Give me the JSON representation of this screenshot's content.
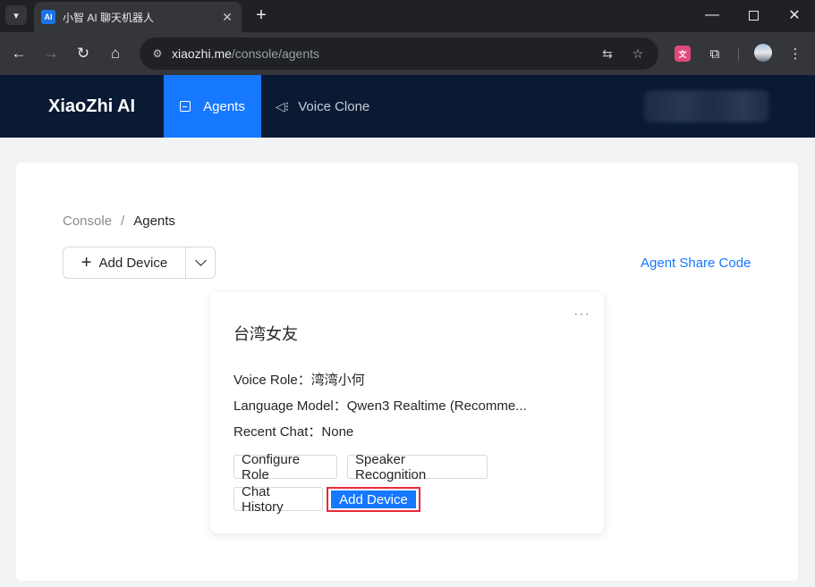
{
  "browser": {
    "tab_title": "小智 AI 聊天机器人",
    "favicon_text": "AI",
    "url_host": "xiaozhi.me",
    "url_path": "/console/agents"
  },
  "header": {
    "logo": "XiaoZhi AI",
    "nav": [
      {
        "label": "Agents",
        "active": true
      },
      {
        "label": "Voice Clone",
        "active": false
      }
    ]
  },
  "breadcrumb": {
    "root": "Console",
    "separator": "/",
    "current": "Agents"
  },
  "actions": {
    "add_device_label": "Add Device",
    "share_code_label": "Agent Share Code"
  },
  "agent_card": {
    "name": "台湾女友",
    "voice_role_label": "Voice Role：",
    "voice_role_value": "湾湾小何",
    "language_model_label": "Language Model：",
    "language_model_value": "Qwen3 Realtime (Recomme...",
    "recent_chat_label": "Recent Chat：",
    "recent_chat_value": "None",
    "buttons": {
      "configure_role": "Configure Role",
      "speaker_recognition": "Speaker Recognition",
      "chat_history": "Chat History",
      "add_device": "Add Device"
    }
  },
  "colors": {
    "accent": "#1677ff",
    "header_bg": "#0a1a33",
    "highlight_border": "#e8293b"
  }
}
